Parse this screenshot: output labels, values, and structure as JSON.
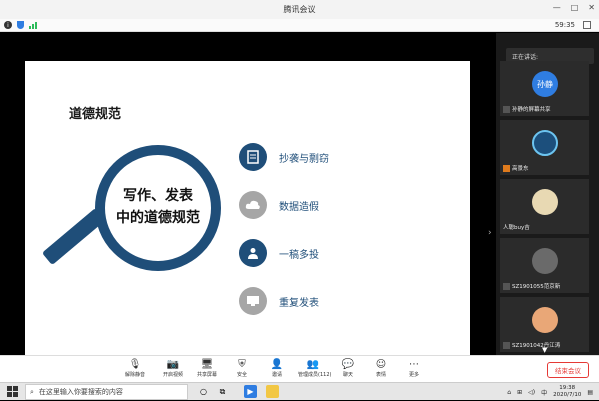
{
  "window": {
    "title": "腾讯会议",
    "controls": [
      "—",
      "□",
      "✕"
    ]
  },
  "status": {
    "time": "59:35"
  },
  "slide": {
    "title": "道德规范",
    "magnifier_text": [
      "写作、发表",
      "中的道德规范"
    ],
    "items": [
      {
        "label": "抄袭与剽窃",
        "icon": "document-icon",
        "style": "blue"
      },
      {
        "label": "数据造假",
        "icon": "cloud-icon",
        "style": "gray"
      },
      {
        "label": "一稿多投",
        "icon": "person-icon",
        "style": "blue"
      },
      {
        "label": "重复发表",
        "icon": "monitor-icon",
        "style": "gray"
      }
    ]
  },
  "panel": {
    "speaking_label": "正在讲话:",
    "participants": [
      {
        "avatar_text": "孙静",
        "name": "孙静的屏幕共享",
        "avatar_color": "#2f7de1",
        "badge": "screen"
      },
      {
        "avatar_text": "",
        "name": "高景东",
        "avatar_color": "#1c4f7c",
        "badge": "host"
      },
      {
        "avatar_text": "",
        "name": "人聪buy吉",
        "avatar_color": "#e8d9b3",
        "badge": ""
      },
      {
        "avatar_text": "",
        "name": "SZ1901055范京新",
        "avatar_color": "#6a6a6a",
        "badge": "mic"
      },
      {
        "avatar_text": "",
        "name": "SZ1901042丹江涛",
        "avatar_color": "#e9a777",
        "badge": "mic"
      }
    ]
  },
  "toolbar": {
    "buttons": [
      {
        "label": "解除静音",
        "icon": "mic-muted-icon",
        "glyph": "🎙"
      },
      {
        "label": "开启视频",
        "icon": "camera-off-icon",
        "glyph": "📷"
      },
      {
        "label": "共享屏幕",
        "icon": "share-screen-icon",
        "glyph": "🖥"
      },
      {
        "label": "安全",
        "icon": "shield-icon",
        "glyph": "⛨"
      },
      {
        "label": "邀请",
        "icon": "invite-icon",
        "glyph": "👤"
      },
      {
        "label": "管理成员(112)",
        "icon": "members-icon",
        "glyph": "👥"
      },
      {
        "label": "聊天",
        "icon": "chat-icon",
        "glyph": "💬"
      },
      {
        "label": "表情",
        "icon": "emoji-icon",
        "glyph": "☺"
      },
      {
        "label": "更多",
        "icon": "more-icon",
        "glyph": "⋯"
      }
    ],
    "end_label": "结束会议"
  },
  "taskbar": {
    "search_placeholder": "在这里输入你要搜索的内容",
    "ime": "中",
    "time": "19:38",
    "date": "2020/7/10"
  }
}
